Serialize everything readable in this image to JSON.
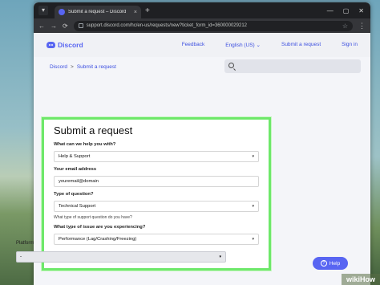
{
  "window": {
    "tab_title": "Submit a request – Discord",
    "close_glyph": "×",
    "newtab_glyph": "+",
    "minimize_glyph": "—",
    "maximize_glyph": "▢",
    "winclose_glyph": "✕"
  },
  "addressbar": {
    "back_glyph": "←",
    "forward_glyph": "→",
    "reload_glyph": "⟳",
    "url": "support.discord.com/hc/en-us/requests/new?ticket_form_id=360000029212",
    "star_glyph": "☆",
    "menu_glyph": "⋮"
  },
  "site": {
    "logo": "Discord",
    "links": [
      "Feedback",
      "English (US) ⌄",
      "Submit a request",
      "Sign in"
    ]
  },
  "breadcrumb": {
    "home": "Discord",
    "separator": ">",
    "current": "Submit a request"
  },
  "form": {
    "title": "Submit a request",
    "q1_label": "What can we help you with?",
    "q1_value": "Help & Support",
    "email_label": "Your email address",
    "email_value": "youremail@domain",
    "type_label": "Type of question?",
    "type_value": "Technical Support",
    "type_hint": "What type of support question do you have?",
    "issue_label": "What type of issue are you experiencing?",
    "issue_value": "Performance (Lag/Crashing/Freezing)",
    "caret_glyph": "▾"
  },
  "platform": {
    "label": "Platform",
    "value": "-"
  },
  "help": {
    "label": "Help",
    "icon_glyph": "?"
  },
  "watermark": "wikiHow",
  "colors": {
    "accent": "#5865f2",
    "highlight": "#6ee86a"
  }
}
